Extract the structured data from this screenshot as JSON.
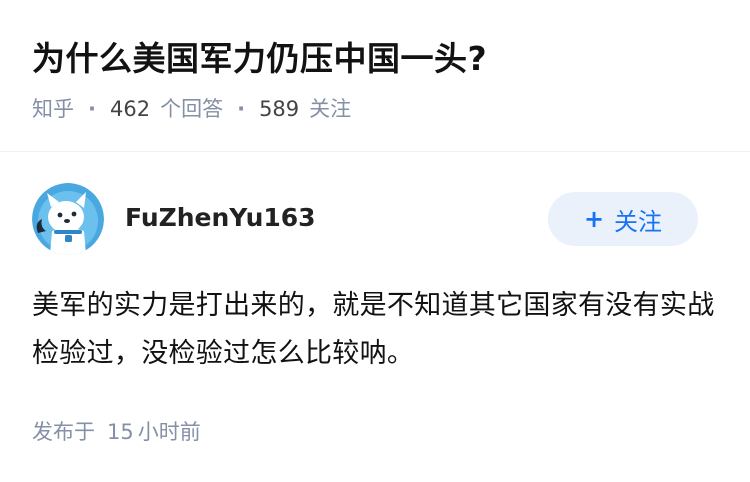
{
  "question": {
    "title": "为什么美国军力仍压中国一头?",
    "source": "知乎",
    "answer_count": "462",
    "answer_label": "个回答",
    "follower_count": "589",
    "follower_label": "关注"
  },
  "answer": {
    "author": {
      "name": "FuZhenYu163",
      "avatar_icon": "husky-avatar-icon"
    },
    "follow_button": {
      "icon": "+",
      "label": "关注"
    },
    "content": "美军的实力是打出来的，就是不知道其它国家有没有实战检验过，没检验过怎么比较呐。",
    "time_prefix": "发布于",
    "time_value": "15",
    "time_unit": "小时前"
  },
  "colors": {
    "accent": "#1772f6",
    "follow_bg": "#eaf1fb",
    "meta_gray": "#8590a6",
    "avatar_bg": "#4aa8e0"
  }
}
